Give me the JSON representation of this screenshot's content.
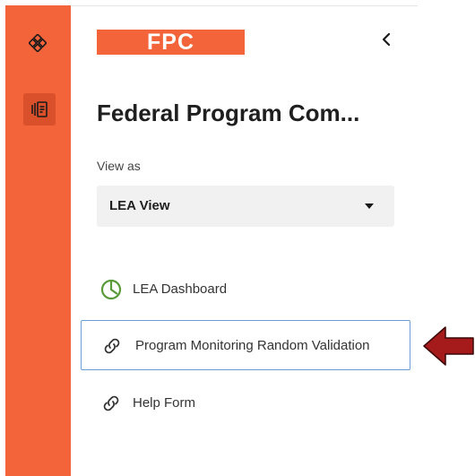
{
  "rail": {
    "items": [
      {
        "icon": "apps-diamond-icon"
      },
      {
        "icon": "document-list-icon",
        "active": true
      }
    ],
    "color": "#f3643a"
  },
  "header": {
    "logo_text": "FPC",
    "collapse_icon": "chevron-left-icon"
  },
  "title": "Federal Program Com...",
  "view_as": {
    "label": "View as",
    "selected": "LEA View"
  },
  "nav": [
    {
      "label": "LEA Dashboard",
      "icon": "pie-chart-icon"
    },
    {
      "label": "Program Monitoring Random Validation",
      "icon": "link-icon",
      "highlighted": true
    },
    {
      "label": "Help Form",
      "icon": "link-icon"
    }
  ],
  "annotation": {
    "icon": "red-arrow-icon",
    "color": "#a51a1a"
  }
}
